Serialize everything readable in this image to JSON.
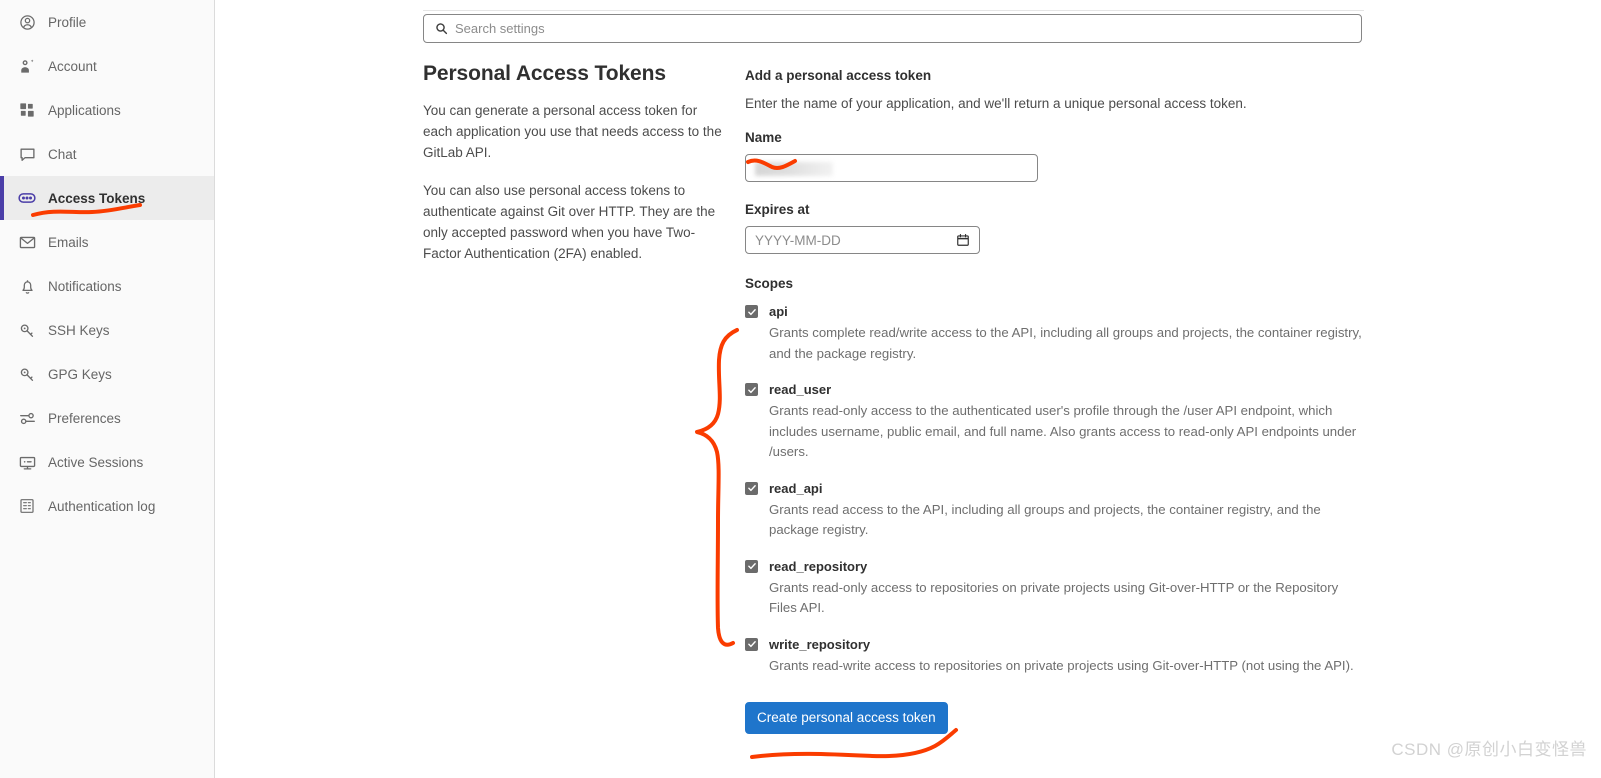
{
  "sidebar": {
    "items": [
      {
        "label": "Profile",
        "icon": "user-circle-icon",
        "active": false
      },
      {
        "label": "Account",
        "icon": "account-gear-icon",
        "active": false
      },
      {
        "label": "Applications",
        "icon": "grid-apps-icon",
        "active": false
      },
      {
        "label": "Chat",
        "icon": "chat-bubble-icon",
        "active": false
      },
      {
        "label": "Access Tokens",
        "icon": "token-pill-icon",
        "active": true
      },
      {
        "label": "Emails",
        "icon": "envelope-icon",
        "active": false
      },
      {
        "label": "Notifications",
        "icon": "bell-icon",
        "active": false
      },
      {
        "label": "SSH Keys",
        "icon": "key-icon",
        "active": false
      },
      {
        "label": "GPG Keys",
        "icon": "key-icon",
        "active": false
      },
      {
        "label": "Preferences",
        "icon": "sliders-icon",
        "active": false
      },
      {
        "label": "Active Sessions",
        "icon": "monitor-icon",
        "active": false
      },
      {
        "label": "Authentication log",
        "icon": "log-list-icon",
        "active": false
      }
    ]
  },
  "search": {
    "placeholder": "Search settings",
    "icon": "search-icon"
  },
  "left": {
    "title": "Personal Access Tokens",
    "paragraphs": [
      "You can generate a personal access token for each application you use that needs access to the GitLab API.",
      "You can also use personal access tokens to authenticate against Git over HTTP. They are the only accepted password when you have Two-Factor Authentication (2FA) enabled."
    ]
  },
  "form": {
    "heading": "Add a personal access token",
    "subheading": "Enter the name of your application, and we'll return a unique personal access token.",
    "name_label": "Name",
    "name_value": "",
    "expires_label": "Expires at",
    "expires_placeholder": "YYYY-MM-DD",
    "expires_value": "",
    "calendar_icon": "calendar-icon",
    "scopes_label": "Scopes",
    "scopes": [
      {
        "name": "api",
        "checked": true,
        "description": "Grants complete read/write access to the API, including all groups and projects, the container registry, and the package registry."
      },
      {
        "name": "read_user",
        "checked": true,
        "description": "Grants read-only access to the authenticated user's profile through the /user API endpoint, which includes username, public email, and full name. Also grants access to read-only API endpoints under /users."
      },
      {
        "name": "read_api",
        "checked": true,
        "description": "Grants read access to the API, including all groups and projects, the container registry, and the package registry."
      },
      {
        "name": "read_repository",
        "checked": true,
        "description": "Grants read-only access to repositories on private projects using Git-over-HTTP or the Repository Files API."
      },
      {
        "name": "write_repository",
        "checked": true,
        "description": "Grants read-write access to repositories on private projects using Git-over-HTTP (not using the API)."
      }
    ],
    "submit_label": "Create personal access token"
  },
  "watermark": {
    "text": "CSDN @原创小白变怪兽"
  },
  "colors": {
    "accent_blue": "#1f75cb",
    "active_nav_bar": "#4b3ea8",
    "annotation_red": "#fa3c00",
    "sidebar_bg": "#fafafa",
    "active_nav_bg": "#ececec"
  }
}
